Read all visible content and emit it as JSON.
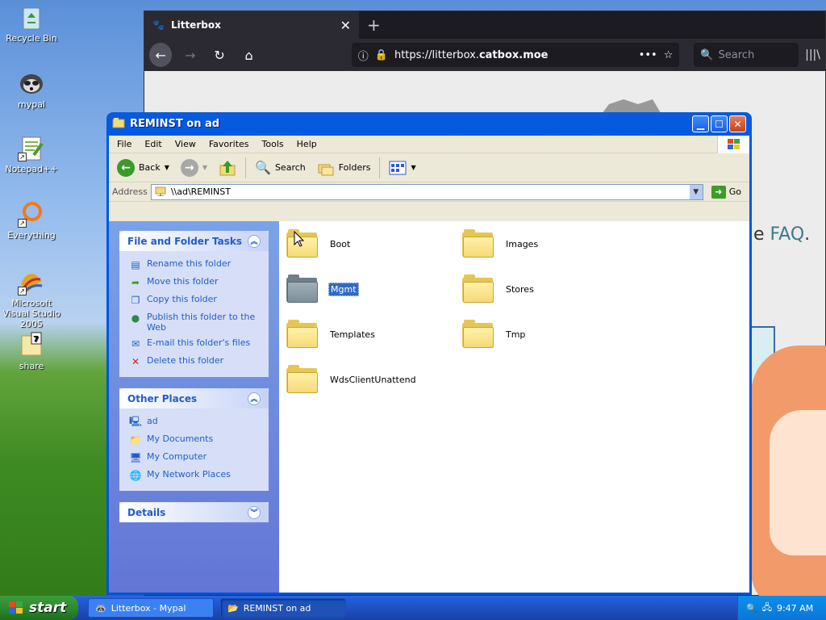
{
  "desktop": {
    "icons": [
      {
        "label": "Recycle Bin"
      },
      {
        "label": "mypal"
      },
      {
        "label": "Notepad++"
      },
      {
        "label": "Everything"
      },
      {
        "label": "Microsoft Visual Studio 2005"
      },
      {
        "label": "share"
      }
    ]
  },
  "browser": {
    "tab_title": "Litterbox",
    "url_prefix": "https://litterbox.",
    "url_host": "catbox.moe",
    "search_placeholder": "Search",
    "faq_prefix": "e ",
    "faq_link": "FAQ",
    "faq_suffix": "."
  },
  "explorer": {
    "title": "REMINST on ad",
    "menu": [
      "File",
      "Edit",
      "View",
      "Favorites",
      "Tools",
      "Help"
    ],
    "toolbar": {
      "back": "Back",
      "search": "Search",
      "folders": "Folders"
    },
    "address_label": "Address",
    "address_value": "\\\\ad\\REMINST",
    "go_label": "Go",
    "file_tasks": {
      "title": "File and Folder Tasks",
      "items": [
        {
          "label": "Rename this folder"
        },
        {
          "label": "Move this folder"
        },
        {
          "label": "Copy this folder"
        },
        {
          "label": "Publish this folder to the Web"
        },
        {
          "label": "E-mail this folder's files"
        },
        {
          "label": "Delete this folder"
        }
      ]
    },
    "other_places": {
      "title": "Other Places",
      "items": [
        {
          "label": "ad"
        },
        {
          "label": "My Documents"
        },
        {
          "label": "My Computer"
        },
        {
          "label": "My Network Places"
        }
      ]
    },
    "details": {
      "title": "Details"
    },
    "folders": [
      {
        "name": "Boot",
        "selected": false
      },
      {
        "name": "Images",
        "selected": false
      },
      {
        "name": "Mgmt",
        "selected": true
      },
      {
        "name": "Stores",
        "selected": false
      },
      {
        "name": "Templates",
        "selected": false
      },
      {
        "name": "Tmp",
        "selected": false
      },
      {
        "name": "WdsClientUnattend",
        "selected": false
      }
    ]
  },
  "taskbar": {
    "start": "start",
    "tasks": [
      {
        "label": "Litterbox - Mypal",
        "active": false
      },
      {
        "label": "REMINST on ad",
        "active": true
      }
    ],
    "clock": "9:47 AM"
  }
}
